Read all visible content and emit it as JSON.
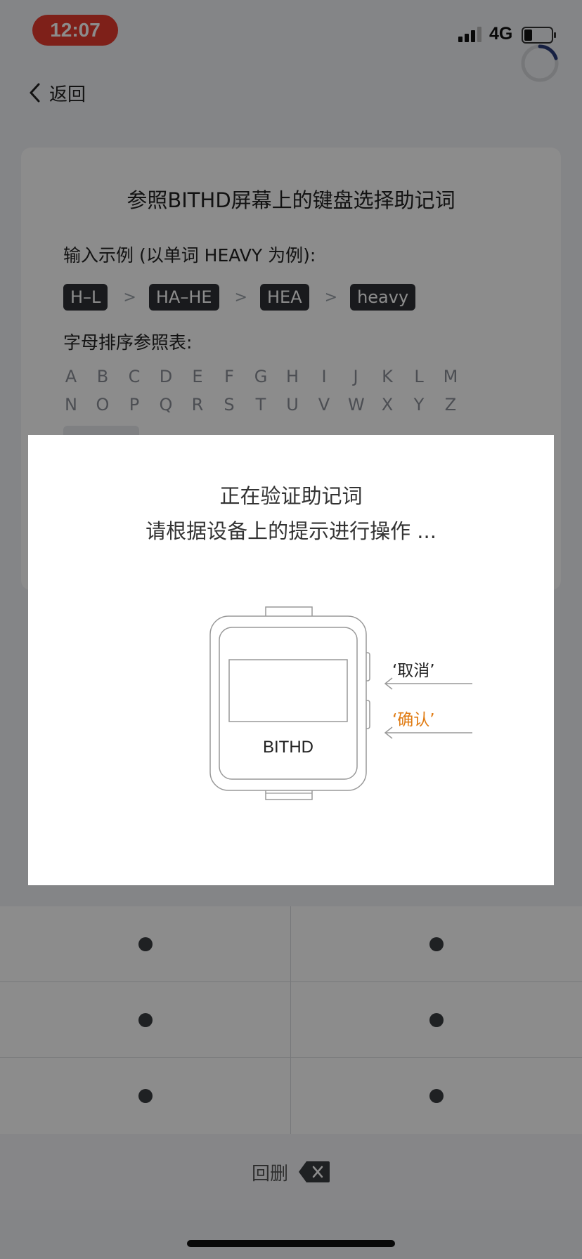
{
  "status_bar": {
    "time": "12:07",
    "network": "4G",
    "icons": [
      "signal-icon",
      "battery-icon",
      "loading-spinner-icon"
    ]
  },
  "nav": {
    "back_label": "返回",
    "icon": "chevron-left-icon"
  },
  "card": {
    "title": "参照BITHD屏幕上的键盘选择助记词",
    "example_label": "输入示例 (以单词 HEAVY 为例):",
    "steps": [
      "H–L",
      "HA–HE",
      "HEA",
      "heavy"
    ],
    "step_separator": ">",
    "order_label": "字母排序参照表:",
    "alphabet": [
      "A",
      "B",
      "C",
      "D",
      "E",
      "F",
      "G",
      "H",
      "I",
      "J",
      "K",
      "L",
      "M",
      "N",
      "O",
      "P",
      "Q",
      "R",
      "S",
      "T",
      "U",
      "V",
      "W",
      "X",
      "Y",
      "Z"
    ]
  },
  "modal": {
    "title_line1": "正在验证助记词",
    "title_line2": "请根据设备上的提示进行操作 ...",
    "device_brand": "BITHD",
    "cancel_hint": "‘取消’",
    "confirm_hint": "‘确认’",
    "colors": {
      "confirm": "#e07b12"
    }
  },
  "keypad": {
    "keys": [
      "●",
      "●",
      "●",
      "●",
      "●",
      "●"
    ],
    "delete_label": "回删",
    "delete_icon": "backspace-icon"
  },
  "colors": {
    "time_pill": "#e53b2e",
    "chip": "#2f3136",
    "overlay": "rgba(0,0,0,0.45)"
  }
}
